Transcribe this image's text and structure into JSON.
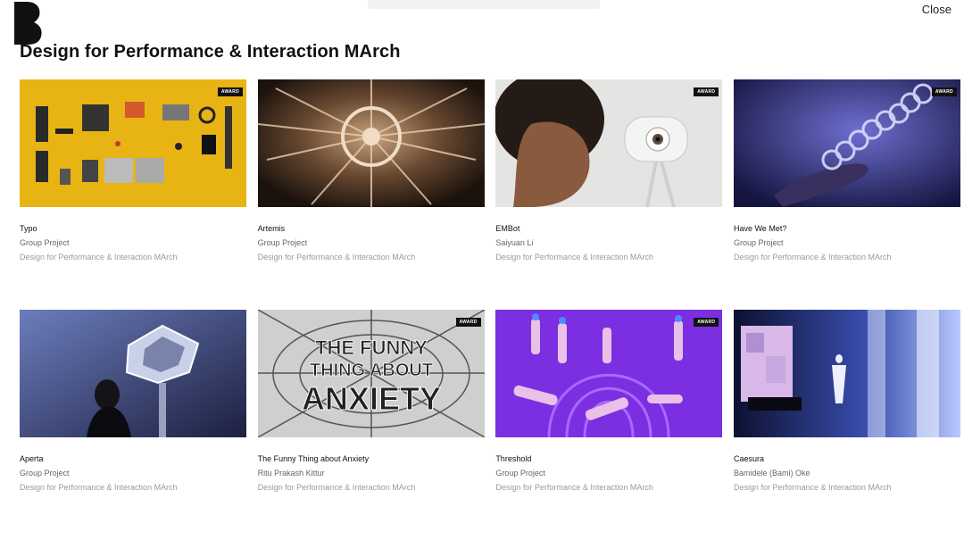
{
  "header": {
    "close_label": "Close",
    "page_title": "Design for Performance & Interaction MArch"
  },
  "colors": {
    "award_badge": "#111111",
    "author_text": "#666666",
    "program_text": "#9a9a9a"
  },
  "cards": [
    {
      "title": "Typo",
      "author": "Group Project",
      "program": "Design for Performance & Interaction MArch",
      "award": "AWARD",
      "image": "yellow-flatlay"
    },
    {
      "title": "Artemis",
      "author": "Group Project",
      "program": "Design for Performance & Interaction MArch",
      "award": "",
      "image": "brown-radial-sculpture"
    },
    {
      "title": "EMBot",
      "author": "Saiyuan Li",
      "program": "Design for Performance & Interaction MArch",
      "award": "AWARD",
      "image": "woman-and-eye-robot"
    },
    {
      "title": "Have We Met?",
      "author": "Group Project",
      "program": "Design for Performance & Interaction MArch",
      "award": "AWARD",
      "image": "hand-with-glass-coil"
    },
    {
      "title": "Aperta",
      "author": "Group Project",
      "program": "Design for Performance & Interaction MArch",
      "award": "",
      "image": "woman-under-lamp"
    },
    {
      "title": "The Funny Thing about Anxiety",
      "author": "Ritu Prakash Kittur",
      "program": "Design for Performance & Interaction MArch",
      "award": "AWARD",
      "image": "anxiety-lettering",
      "image_text": [
        "THE FUNNY",
        "THING ABOUT",
        "ANXIETY"
      ]
    },
    {
      "title": "Threshold",
      "author": "Group Project",
      "program": "Design for Performance & Interaction MArch",
      "award": "AWARD",
      "image": "purple-motion-capture"
    },
    {
      "title": "Caesura",
      "author": "Bamidele (Bami) Oke",
      "program": "Design for Performance & Interaction MArch",
      "award": "",
      "image": "blue-performance-room"
    }
  ]
}
